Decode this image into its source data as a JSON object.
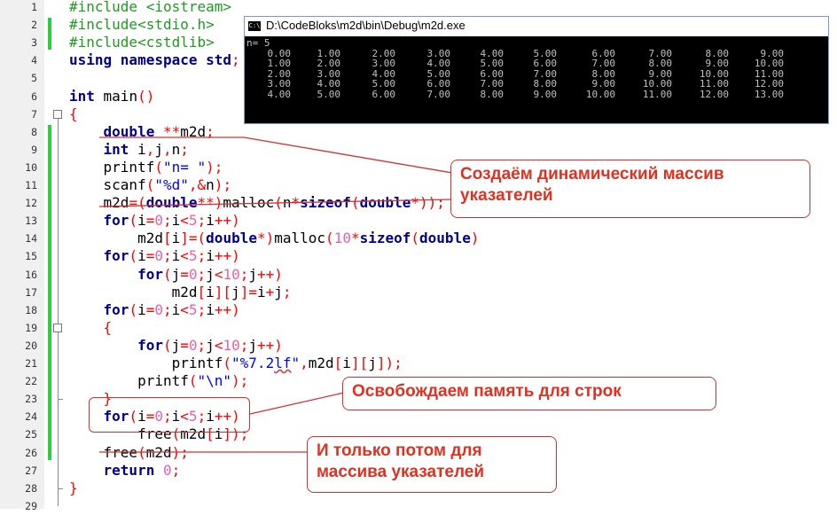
{
  "line_numbers": [
    "1",
    "2",
    "3",
    "4",
    "5",
    "6",
    "7",
    "8",
    "9",
    "10",
    "11",
    "12",
    "13",
    "14",
    "15",
    "16",
    "17",
    "18",
    "19",
    "20",
    "21",
    "22",
    "23",
    "24",
    "25",
    "26",
    "27",
    "28",
    "29"
  ],
  "code_lines": [
    [
      {
        "c": "pp",
        "t": "#include <iostream>"
      }
    ],
    [
      {
        "c": "pp",
        "t": "#include<stdio.h>"
      }
    ],
    [
      {
        "c": "pp",
        "t": "#include<cstdlib>"
      }
    ],
    [
      {
        "c": "kw",
        "t": "using namespace "
      },
      {
        "c": "kw",
        "t": "std"
      },
      {
        "c": "op",
        "t": ";"
      }
    ],
    [],
    [
      {
        "c": "kw",
        "t": "int"
      },
      {
        "c": "plain",
        "t": " main"
      },
      {
        "c": "br",
        "t": "()"
      }
    ],
    [
      {
        "c": "br",
        "t": "{"
      }
    ],
    [
      {
        "c": "plain",
        "t": "    "
      },
      {
        "c": "kw",
        "t": "double"
      },
      {
        "c": "plain",
        "t": " "
      },
      {
        "c": "op",
        "t": "**"
      },
      {
        "c": "plain",
        "t": "m2d"
      },
      {
        "c": "op",
        "t": ";"
      }
    ],
    [
      {
        "c": "plain",
        "t": "    "
      },
      {
        "c": "kw",
        "t": "int"
      },
      {
        "c": "plain",
        "t": " i"
      },
      {
        "c": "op",
        "t": ","
      },
      {
        "c": "plain",
        "t": "j"
      },
      {
        "c": "op",
        "t": ","
      },
      {
        "c": "plain",
        "t": "n"
      },
      {
        "c": "op",
        "t": ";"
      }
    ],
    [
      {
        "c": "plain",
        "t": "    printf"
      },
      {
        "c": "br",
        "t": "("
      },
      {
        "c": "str",
        "t": "\"n= \""
      },
      {
        "c": "br",
        "t": ")"
      },
      {
        "c": "op",
        "t": ";"
      }
    ],
    [
      {
        "c": "plain",
        "t": "    scanf"
      },
      {
        "c": "br",
        "t": "("
      },
      {
        "c": "str",
        "t": "\"%d\""
      },
      {
        "c": "op",
        "t": ","
      },
      {
        "c": "op",
        "t": "&"
      },
      {
        "c": "plain",
        "t": "n"
      },
      {
        "c": "br",
        "t": ")"
      },
      {
        "c": "op",
        "t": ";"
      }
    ],
    [
      {
        "c": "plain",
        "t": "    m2d"
      },
      {
        "c": "op",
        "t": "="
      },
      {
        "c": "br",
        "t": "("
      },
      {
        "c": "kw",
        "t": "double"
      },
      {
        "c": "op",
        "t": "**"
      },
      {
        "c": "br",
        "t": ")"
      },
      {
        "c": "plain",
        "t": "malloc"
      },
      {
        "c": "br",
        "t": "("
      },
      {
        "c": "plain",
        "t": "n"
      },
      {
        "c": "op",
        "t": "*"
      },
      {
        "c": "kw",
        "t": "sizeof"
      },
      {
        "c": "br",
        "t": "("
      },
      {
        "c": "kw",
        "t": "double"
      },
      {
        "c": "op",
        "t": "*"
      },
      {
        "c": "br",
        "t": "))"
      },
      {
        "c": "op",
        "t": ";"
      }
    ],
    [
      {
        "c": "plain",
        "t": "    "
      },
      {
        "c": "kw",
        "t": "for"
      },
      {
        "c": "br",
        "t": "("
      },
      {
        "c": "plain",
        "t": "i"
      },
      {
        "c": "op",
        "t": "="
      },
      {
        "c": "num",
        "t": "0"
      },
      {
        "c": "op",
        "t": ";"
      },
      {
        "c": "plain",
        "t": "i"
      },
      {
        "c": "op",
        "t": "<"
      },
      {
        "c": "num",
        "t": "5"
      },
      {
        "c": "op",
        "t": ";"
      },
      {
        "c": "plain",
        "t": "i"
      },
      {
        "c": "op",
        "t": "++"
      },
      {
        "c": "br",
        "t": ")"
      }
    ],
    [
      {
        "c": "plain",
        "t": "        m2d"
      },
      {
        "c": "br",
        "t": "["
      },
      {
        "c": "plain",
        "t": "i"
      },
      {
        "c": "br",
        "t": "]"
      },
      {
        "c": "op",
        "t": "="
      },
      {
        "c": "br",
        "t": "("
      },
      {
        "c": "kw",
        "t": "double"
      },
      {
        "c": "op",
        "t": "*"
      },
      {
        "c": "br",
        "t": ")"
      },
      {
        "c": "plain",
        "t": "malloc"
      },
      {
        "c": "br",
        "t": "("
      },
      {
        "c": "num",
        "t": "10"
      },
      {
        "c": "op",
        "t": "*"
      },
      {
        "c": "kw",
        "t": "sizeof"
      },
      {
        "c": "br",
        "t": "("
      },
      {
        "c": "kw",
        "t": "double"
      },
      {
        "c": "br",
        "t": ")"
      }
    ],
    [
      {
        "c": "plain",
        "t": "    "
      },
      {
        "c": "kw",
        "t": "for"
      },
      {
        "c": "br",
        "t": "("
      },
      {
        "c": "plain",
        "t": "i"
      },
      {
        "c": "op",
        "t": "="
      },
      {
        "c": "num",
        "t": "0"
      },
      {
        "c": "op",
        "t": ";"
      },
      {
        "c": "plain",
        "t": "i"
      },
      {
        "c": "op",
        "t": "<"
      },
      {
        "c": "num",
        "t": "5"
      },
      {
        "c": "op",
        "t": ";"
      },
      {
        "c": "plain",
        "t": "i"
      },
      {
        "c": "op",
        "t": "++"
      },
      {
        "c": "br",
        "t": ")"
      }
    ],
    [
      {
        "c": "plain",
        "t": "        "
      },
      {
        "c": "kw",
        "t": "for"
      },
      {
        "c": "br",
        "t": "("
      },
      {
        "c": "plain",
        "t": "j"
      },
      {
        "c": "op",
        "t": "="
      },
      {
        "c": "num",
        "t": "0"
      },
      {
        "c": "op",
        "t": ";"
      },
      {
        "c": "plain",
        "t": "j"
      },
      {
        "c": "op",
        "t": "<"
      },
      {
        "c": "num",
        "t": "10"
      },
      {
        "c": "op",
        "t": ";"
      },
      {
        "c": "plain",
        "t": "j"
      },
      {
        "c": "op",
        "t": "++"
      },
      {
        "c": "br",
        "t": ")"
      }
    ],
    [
      {
        "c": "plain",
        "t": "            m2d"
      },
      {
        "c": "br",
        "t": "["
      },
      {
        "c": "plain",
        "t": "i"
      },
      {
        "c": "br",
        "t": "]["
      },
      {
        "c": "plain",
        "t": "j"
      },
      {
        "c": "br",
        "t": "]"
      },
      {
        "c": "op",
        "t": "="
      },
      {
        "c": "plain",
        "t": "i"
      },
      {
        "c": "op",
        "t": "+"
      },
      {
        "c": "plain",
        "t": "j"
      },
      {
        "c": "op",
        "t": ";"
      }
    ],
    [
      {
        "c": "plain",
        "t": "    "
      },
      {
        "c": "kw",
        "t": "for"
      },
      {
        "c": "br",
        "t": "("
      },
      {
        "c": "plain",
        "t": "i"
      },
      {
        "c": "op",
        "t": "="
      },
      {
        "c": "num",
        "t": "0"
      },
      {
        "c": "op",
        "t": ";"
      },
      {
        "c": "plain",
        "t": "i"
      },
      {
        "c": "op",
        "t": "<"
      },
      {
        "c": "num",
        "t": "5"
      },
      {
        "c": "op",
        "t": ";"
      },
      {
        "c": "plain",
        "t": "i"
      },
      {
        "c": "op",
        "t": "++"
      },
      {
        "c": "br",
        "t": ")"
      }
    ],
    [
      {
        "c": "plain",
        "t": "    "
      },
      {
        "c": "br",
        "t": "{"
      }
    ],
    [
      {
        "c": "plain",
        "t": "        "
      },
      {
        "c": "kw",
        "t": "for"
      },
      {
        "c": "br",
        "t": "("
      },
      {
        "c": "plain",
        "t": "j"
      },
      {
        "c": "op",
        "t": "="
      },
      {
        "c": "num",
        "t": "0"
      },
      {
        "c": "op",
        "t": ";"
      },
      {
        "c": "plain",
        "t": "j"
      },
      {
        "c": "op",
        "t": "<"
      },
      {
        "c": "num",
        "t": "10"
      },
      {
        "c": "op",
        "t": ";"
      },
      {
        "c": "plain",
        "t": "j"
      },
      {
        "c": "op",
        "t": "++"
      },
      {
        "c": "br",
        "t": ")"
      }
    ],
    [
      {
        "c": "plain",
        "t": "            printf"
      },
      {
        "c": "br",
        "t": "("
      },
      {
        "c": "str",
        "t": "\"%7.2"
      },
      {
        "c": "str squig",
        "t": "lf"
      },
      {
        "c": "str",
        "t": "\""
      },
      {
        "c": "op",
        "t": ","
      },
      {
        "c": "plain",
        "t": "m2d"
      },
      {
        "c": "br",
        "t": "["
      },
      {
        "c": "plain",
        "t": "i"
      },
      {
        "c": "br",
        "t": "]["
      },
      {
        "c": "plain",
        "t": "j"
      },
      {
        "c": "br",
        "t": "])"
      },
      {
        "c": "op",
        "t": ";"
      }
    ],
    [
      {
        "c": "plain",
        "t": "        printf"
      },
      {
        "c": "br",
        "t": "("
      },
      {
        "c": "str",
        "t": "\"\\n\""
      },
      {
        "c": "br",
        "t": ")"
      },
      {
        "c": "op",
        "t": ";"
      }
    ],
    [
      {
        "c": "plain",
        "t": "    "
      },
      {
        "c": "br",
        "t": "}"
      }
    ],
    [
      {
        "c": "plain",
        "t": "    "
      },
      {
        "c": "kw",
        "t": "for"
      },
      {
        "c": "br",
        "t": "("
      },
      {
        "c": "plain",
        "t": "i"
      },
      {
        "c": "op",
        "t": "="
      },
      {
        "c": "num",
        "t": "0"
      },
      {
        "c": "op",
        "t": ";"
      },
      {
        "c": "plain",
        "t": "i"
      },
      {
        "c": "op",
        "t": "<"
      },
      {
        "c": "num",
        "t": "5"
      },
      {
        "c": "op",
        "t": ";"
      },
      {
        "c": "plain",
        "t": "i"
      },
      {
        "c": "op",
        "t": "++"
      },
      {
        "c": "br",
        "t": ")"
      }
    ],
    [
      {
        "c": "plain",
        "t": "        free"
      },
      {
        "c": "br",
        "t": "("
      },
      {
        "c": "plain",
        "t": "m2d"
      },
      {
        "c": "br",
        "t": "["
      },
      {
        "c": "plain",
        "t": "i"
      },
      {
        "c": "br",
        "t": "])"
      },
      {
        "c": "op",
        "t": ";"
      }
    ],
    [
      {
        "c": "plain",
        "t": "    free"
      },
      {
        "c": "br",
        "t": "("
      },
      {
        "c": "plain",
        "t": "m2d"
      },
      {
        "c": "br",
        "t": ")"
      },
      {
        "c": "op",
        "t": ";"
      }
    ],
    [
      {
        "c": "plain",
        "t": "    "
      },
      {
        "c": "kw",
        "t": "return"
      },
      {
        "c": "plain",
        "t": " "
      },
      {
        "c": "num",
        "t": "0"
      },
      {
        "c": "op",
        "t": ";"
      }
    ],
    [
      {
        "c": "br",
        "t": "}"
      }
    ],
    []
  ],
  "console": {
    "title": "D:\\CodeBloks\\m2d\\bin\\Debug\\m2d.exe",
    "icon_label": "C:\\",
    "prompt_line": "n= 5",
    "rows": [
      [
        "0.00",
        "1.00",
        "2.00",
        "3.00",
        "4.00",
        "5.00",
        "6.00",
        "7.00",
        "8.00",
        "9.00"
      ],
      [
        "1.00",
        "2.00",
        "3.00",
        "4.00",
        "5.00",
        "6.00",
        "7.00",
        "8.00",
        "9.00",
        "10.00"
      ],
      [
        "2.00",
        "3.00",
        "4.00",
        "5.00",
        "6.00",
        "7.00",
        "8.00",
        "9.00",
        "10.00",
        "11.00"
      ],
      [
        "3.00",
        "4.00",
        "5.00",
        "6.00",
        "7.00",
        "8.00",
        "9.00",
        "10.00",
        "11.00",
        "12.00"
      ],
      [
        "4.00",
        "5.00",
        "6.00",
        "7.00",
        "8.00",
        "9.00",
        "10.00",
        "11.00",
        "12.00",
        "13.00"
      ]
    ]
  },
  "callouts": {
    "create": "Создаём динамический массив указателей",
    "free_rows": "Освобождаем память для строк",
    "free_ptrs": "И только потом для массива указателей"
  },
  "colors": {
    "callout_border": "#d03030",
    "callout_text": "#e03020",
    "change_bar": "#2ecc40",
    "console_bg": "#000000",
    "console_text": "#c0c0c0"
  }
}
